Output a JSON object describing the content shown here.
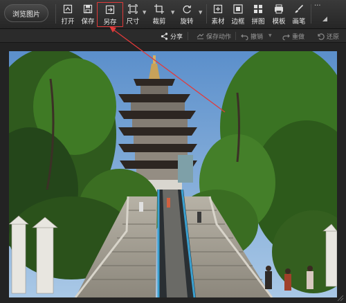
{
  "toolbar": {
    "browse_label": "浏览图片",
    "tools": [
      {
        "label": "打开",
        "icon": "open-icon"
      },
      {
        "label": "保存",
        "icon": "save-icon"
      },
      {
        "label": "另存",
        "icon": "save-as-icon",
        "highlighted": true
      },
      {
        "label": "尺寸",
        "icon": "resize-icon"
      },
      {
        "label": "裁剪",
        "icon": "crop-icon"
      },
      {
        "label": "旋转",
        "icon": "rotate-icon"
      },
      {
        "label": "素材",
        "icon": "material-icon"
      },
      {
        "label": "边框",
        "icon": "frame-icon"
      },
      {
        "label": "拼图",
        "icon": "collage-icon"
      },
      {
        "label": "模板",
        "icon": "template-icon"
      },
      {
        "label": "画笔",
        "icon": "brush-icon"
      }
    ],
    "more_label": "···"
  },
  "subbar": {
    "share": "分享",
    "save_action": "保存动作",
    "undo": "撤销",
    "redo": "重做",
    "restore": "还原"
  },
  "annotation": {
    "color": "#e23a3a"
  },
  "photo": {
    "subject": "pagoda with stone staircase and escalator among green trees"
  }
}
